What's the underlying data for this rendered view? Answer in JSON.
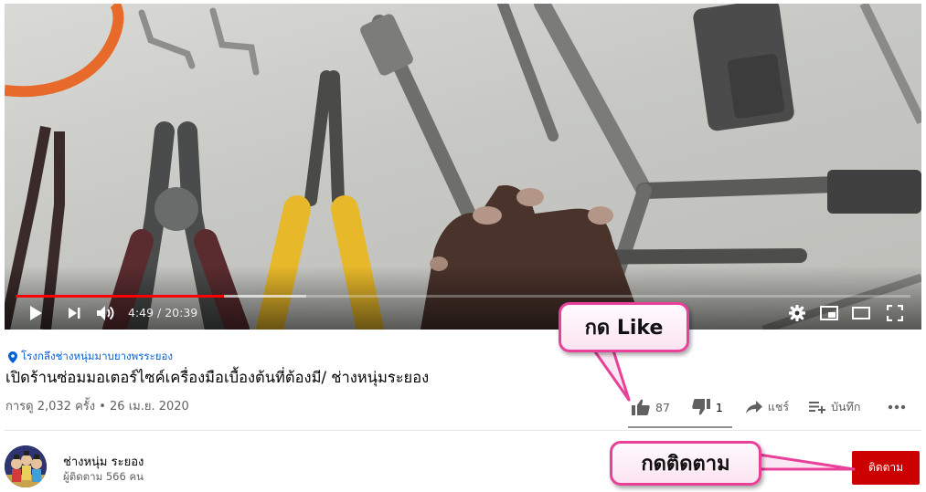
{
  "player": {
    "time_current": "4:49",
    "time_total": "20:39",
    "time_display": "4:49 / 20:39",
    "played_fraction": 0.233,
    "buffered_fraction": 0.325,
    "controls": [
      "play-icon",
      "next-icon",
      "volume-icon",
      "settings-icon",
      "miniplayer-icon",
      "theater-icon",
      "fullscreen-icon"
    ],
    "accent_color": "#ff0000"
  },
  "video": {
    "location": "โรงกลึงช่างหนุ่มมาบยางพรระยอง",
    "title": "เปิดร้านซ่อมมอเตอร์ไซค์เครื่องมือเบื้องต้นที่ต้องมี/ ช่างหนุ่มระยอง",
    "views_date": "การดู 2,032 ครั้ง • 26 เม.ย. 2020"
  },
  "actions": {
    "likes": "87",
    "dislikes": "1",
    "share_label": "แชร์",
    "save_label": "บันทึก"
  },
  "channel": {
    "name": "ช่างหนุ่ม ระยอง",
    "subscribers": "ผู้ติดตาม 566 คน",
    "subscribe_label": "ติดตาม",
    "subscribe_color": "#cc0000"
  },
  "callouts": {
    "like_text": "กด Like",
    "subscribe_text": "กดติดตาม",
    "border_color": "#e9409a"
  }
}
